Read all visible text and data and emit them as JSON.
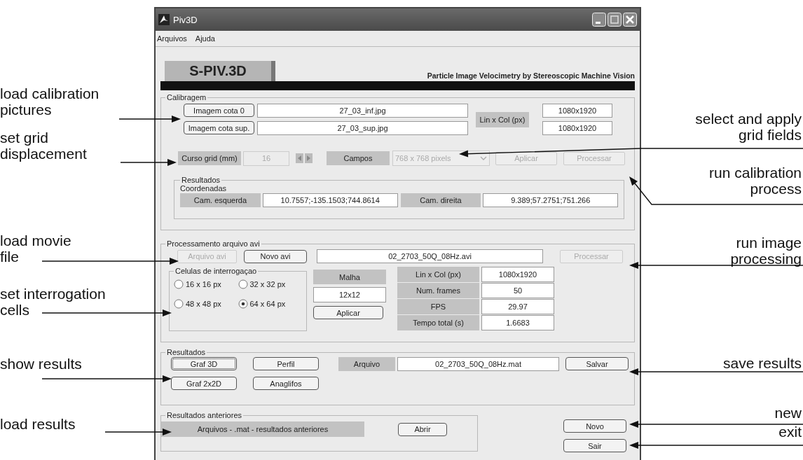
{
  "window": {
    "title": "Piv3D"
  },
  "menu": [
    "Arquivos",
    "Ajuda"
  ],
  "header": {
    "logo": "S-PIV.3D",
    "subtitle": "Particle Image Velocimetry by Stereoscopic Machine Vision"
  },
  "calibration": {
    "title": "Calibragem",
    "images": [
      {
        "label": "Imagem cota 0",
        "file": "27_03_inf.jpg"
      },
      {
        "label": "Imagem cota sup.",
        "file": "27_03_sup.jpg"
      }
    ],
    "size_label": "Lin x Col (px)",
    "sizes": [
      "1080x1920",
      "1080x1920"
    ],
    "grid_label": "Curso grid (mm)",
    "grid_value": "16",
    "grid_disabled": true,
    "fields_label": "Campos",
    "fields_value": "768 x 768 pixels",
    "fields_disabled": true,
    "buttons": [
      {
        "label": "Aplicar",
        "disabled": true
      },
      {
        "label": "Processar",
        "disabled": true
      }
    ],
    "results": {
      "title": "Resultados",
      "subtitle": "Coordenadas",
      "cameras": [
        {
          "label": "Cam. esquerda",
          "value": "10.7557;-135.1503;744.8614"
        },
        {
          "label": "Cam. direita",
          "value": "9.389;57.2751;751.266"
        }
      ]
    }
  },
  "avi": {
    "title": "Processamento arquivo avi",
    "buttons": [
      {
        "label": "Arquivo avi",
        "disabled": true
      },
      {
        "label": "Novo avi",
        "disabled": false
      }
    ],
    "file": "02_2703_50Q_08Hz.avi",
    "process": {
      "label": "Processar",
      "disabled": true
    },
    "cells": {
      "title": "Celulas de interrogaçao",
      "options": [
        {
          "label": "16 x 16 px",
          "selected": false
        },
        {
          "label": "32 x 32 px",
          "selected": false
        },
        {
          "label": "48 x 48 px",
          "selected": false
        },
        {
          "label": "64 x 64 px",
          "selected": true
        }
      ]
    },
    "mesh": {
      "label": "Malha",
      "value": "12x12",
      "button": "Aplicar"
    },
    "info": [
      {
        "label": "Lin x Col (px)",
        "value": "1080x1920"
      },
      {
        "label": "Num. frames",
        "value": "50"
      },
      {
        "label": "FPS",
        "value": "29.97"
      },
      {
        "label": "Tempo total (s)",
        "value": "1.6683"
      }
    ]
  },
  "results": {
    "title": "Resultados",
    "buttons": [
      {
        "label": "Graf 3D",
        "focused": true
      },
      {
        "label": "Perfil",
        "focused": false
      },
      {
        "label": "Graf 2x2D",
        "focused": false
      },
      {
        "label": "Anaglifos",
        "focused": false
      }
    ],
    "file_label": "Arquivo",
    "file": "02_2703_50Q_08Hz.mat",
    "save": "Salvar"
  },
  "previous": {
    "title": "Resultados anteriores",
    "label": "Arquivos  -  .mat  -  resultados anteriores",
    "open": "Abrir"
  },
  "actions": [
    "Novo",
    "Sair"
  ],
  "annotations": [
    {
      "kind": "left",
      "text": "load calibration\npictures"
    },
    {
      "kind": "left",
      "text": "set grid\ndisplacement"
    },
    {
      "kind": "left",
      "text": "load movie\nfile"
    },
    {
      "kind": "left",
      "text": "set interrogation\ncells"
    },
    {
      "kind": "left",
      "text": "show results"
    },
    {
      "kind": "left",
      "text": "load results"
    },
    {
      "kind": "right",
      "text": "select and apply\ngrid fields"
    },
    {
      "kind": "right",
      "text": "run calibration\nprocess"
    },
    {
      "kind": "right",
      "text": "run image\nprocessing"
    },
    {
      "kind": "right",
      "text": "save results"
    },
    {
      "kind": "right",
      "text": "new"
    },
    {
      "kind": "right",
      "text": "exit"
    }
  ]
}
